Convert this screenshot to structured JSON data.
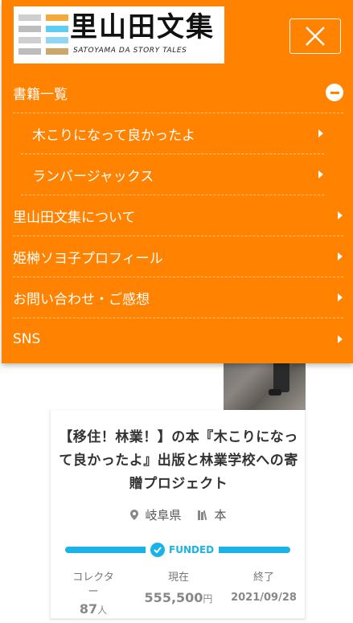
{
  "header": {
    "logo_title": "里山田文集",
    "logo_subtitle": "SATOYAMA DA STORY TALES"
  },
  "menu": {
    "items": [
      {
        "label": "書籍一覧",
        "icon": "minus-circle-icon"
      },
      {
        "label": "木こりになって良かったよ",
        "icon": "chevron-right-icon"
      },
      {
        "label": "ランバージャックス",
        "icon": "chevron-right-icon"
      },
      {
        "label": "里山田文集について",
        "icon": "chevron-right-icon"
      },
      {
        "label": "姫榊ソヨ子プロフィール",
        "icon": "chevron-right-icon"
      },
      {
        "label": "お問い合わせ・ご感想",
        "icon": "chevron-right-icon"
      },
      {
        "label": "SNS",
        "icon": "chevron-right-icon"
      }
    ]
  },
  "project": {
    "title": "【移住！林業！】の本『木こりになって良かったよ』出版と林業学校への寄贈プロジェクト",
    "location": "岐阜県",
    "category": "本",
    "status": "FUNDED",
    "progress": 1.0,
    "stats": {
      "collector_label": "コレクター",
      "collector_value": "87",
      "collector_unit": "人",
      "current_label": "現在",
      "current_value": "555,500",
      "current_unit": "円",
      "end_label": "終了",
      "end_value": "2021/09/28"
    }
  },
  "colors": {
    "accent": "#ff8200",
    "funded": "#19b3ea"
  }
}
